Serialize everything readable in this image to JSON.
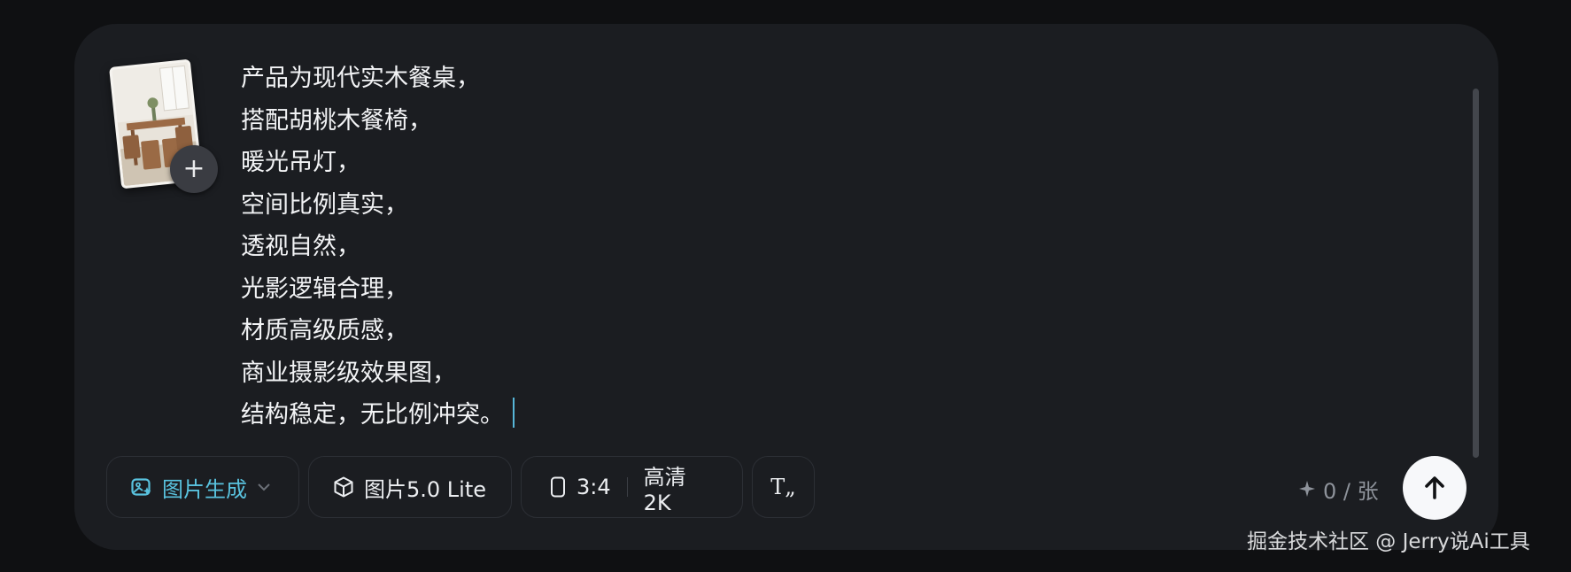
{
  "prompt": {
    "lines": [
      "产品为现代实木餐桌，",
      "搭配胡桃木餐椅，",
      "暖光吊灯，",
      "空间比例真实，",
      "透视自然，",
      "光影逻辑合理，",
      "材质高级质感，",
      "商业摄影级效果图，",
      "结构稳定，无比例冲突。"
    ]
  },
  "reference_image": {
    "add_label": "+"
  },
  "toolbar": {
    "mode_label": "图片生成",
    "model_label": "图片5.0 Lite",
    "ratio_label": "3:4",
    "quality_label": "高清 2K",
    "text_icon_label": "T„"
  },
  "credits": {
    "text": "0 / 张"
  },
  "watermark": "掘金技术社区 @ Jerry说Ai工具",
  "colors": {
    "accent": "#59c2de",
    "panel": "#1b1d21",
    "background": "#0f1012",
    "send_button": "#f7f8fa"
  },
  "icons": {
    "mode": "image-sparkle-icon",
    "dropdown": "chevron-down-icon",
    "model": "cube-icon",
    "ratio": "portrait-rect-icon",
    "text": "text-format-icon",
    "credits": "sparkle-icon",
    "send": "arrow-up-icon",
    "add": "plus-icon"
  }
}
